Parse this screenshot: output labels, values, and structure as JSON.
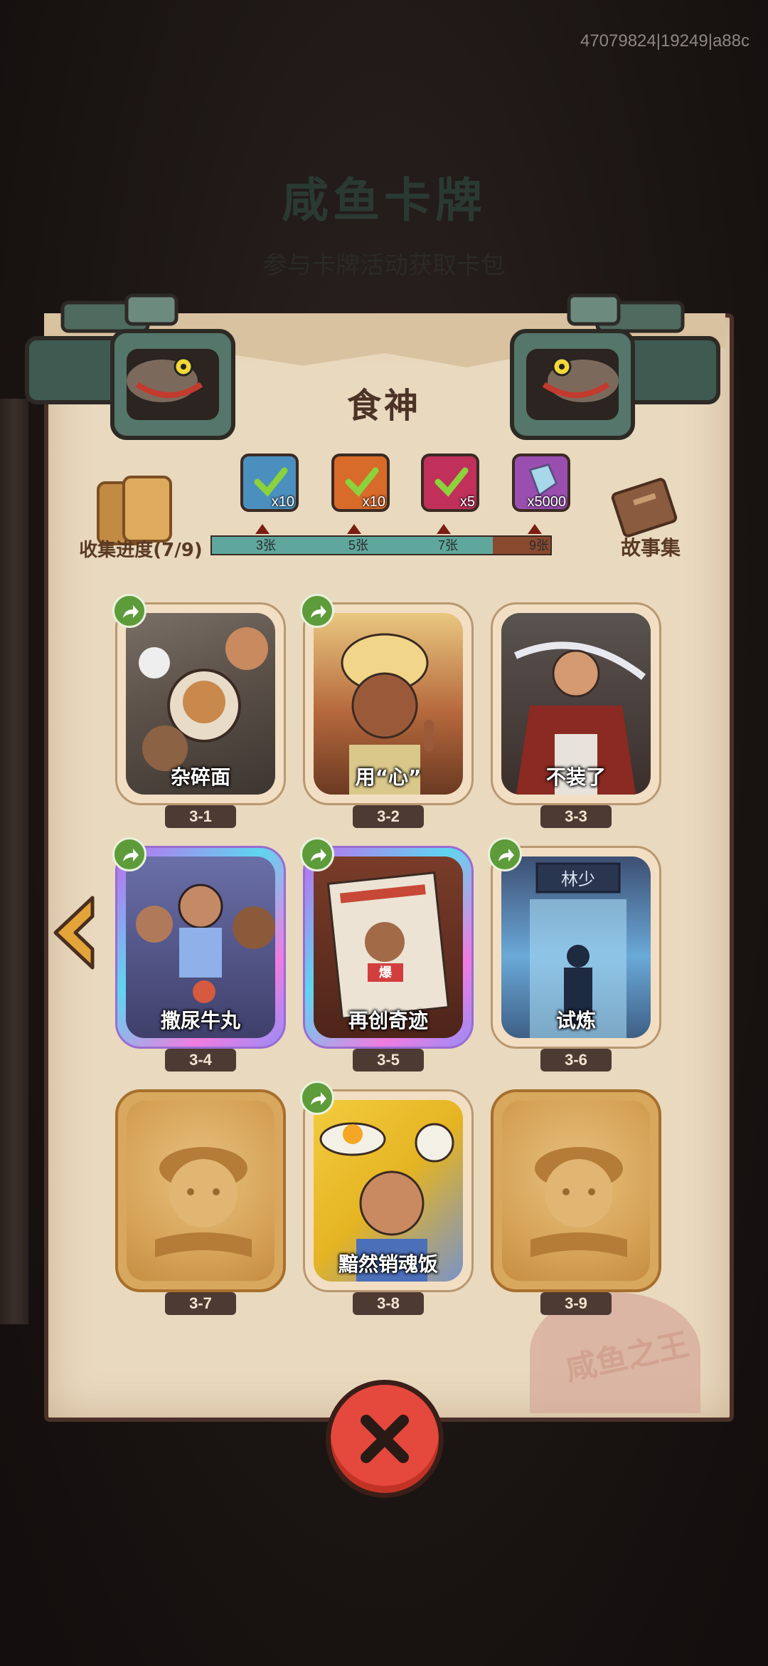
{
  "version_text": "47079824|19249|a88c",
  "background": {
    "title": "咸鱼卡牌",
    "subtitle": "参与卡牌活动获取卡包"
  },
  "panel": {
    "title": "食神",
    "collect_label": "收集进度(7/9)",
    "story_label": "故事集",
    "progress_fraction": 0.83
  },
  "rewards": [
    {
      "qty": "x10",
      "threshold": "3张",
      "color": "#4a8fbe"
    },
    {
      "qty": "x10",
      "threshold": "5张",
      "color": "#d86a2a"
    },
    {
      "qty": "x5",
      "threshold": "7张",
      "color": "#c0305a"
    },
    {
      "qty": "x5000",
      "threshold": "9张",
      "color": "#9a4fb0"
    }
  ],
  "cards": [
    {
      "code": "3-1",
      "name": "杂碎面",
      "collected": true,
      "holo": false
    },
    {
      "code": "3-2",
      "name": "用“心”",
      "collected": true,
      "holo": false
    },
    {
      "code": "3-3",
      "name": "不装了",
      "collected": true,
      "holo": false
    },
    {
      "code": "3-4",
      "name": "撒尿牛丸",
      "collected": true,
      "holo": true
    },
    {
      "code": "3-5",
      "name": "再创奇迹",
      "collected": true,
      "holo": true
    },
    {
      "code": "3-6",
      "name": "试炼",
      "collected": true,
      "holo": false
    },
    {
      "code": "3-7",
      "name": "",
      "collected": false,
      "holo": false
    },
    {
      "code": "3-8",
      "name": "黯然销魂饭",
      "collected": true,
      "holo": false
    },
    {
      "code": "3-9",
      "name": "",
      "collected": false,
      "holo": false
    }
  ],
  "card_art_signs": {
    "door_sign": "林少",
    "newspaper_tag": "爆"
  },
  "colors": {
    "accent_red": "#e5483c",
    "share_green": "#5e9b3a",
    "progress_teal": "#5fa79c"
  }
}
